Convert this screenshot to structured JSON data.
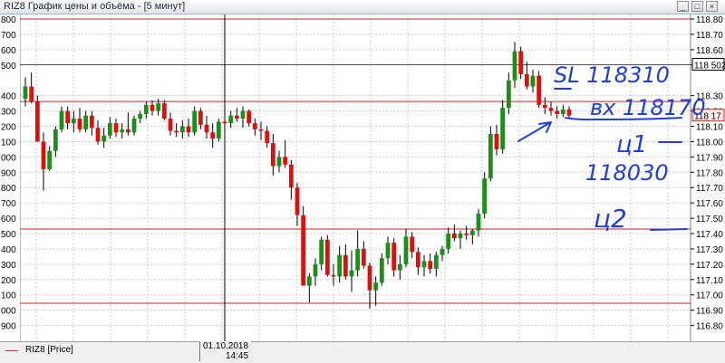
{
  "window": {
    "title": "RIZ8 График цены и объёма - [5 минут]",
    "buttons": [
      "_",
      "□",
      "×"
    ]
  },
  "legend": {
    "label": "RIZ8 [Price]",
    "color": "#d03030"
  },
  "cursor": {
    "date": "01.10.2018",
    "time": "14:45"
  },
  "chart_data": {
    "type": "candlestick",
    "title": "",
    "xlabel": "",
    "ylabel": "",
    "ylim": [
      116890,
      118800
    ],
    "left_tick_labels": [
      "800",
      "700",
      "600",
      "500",
      "400",
      "300",
      "200",
      "100",
      "000",
      "900",
      "800",
      "700",
      "600",
      "500",
      "400",
      "300",
      "200",
      "100",
      "000",
      "900"
    ],
    "right_tick_labels": [
      "118.80",
      "118.70",
      "118.60",
      "118.50",
      "118.30",
      "118.20",
      "118.10",
      "118.00",
      "117.90",
      "117.80",
      "117.70",
      "117.60",
      "117.50",
      "117.40",
      "117.30",
      "117.20",
      "117.10",
      "117.00",
      "116.90",
      "116.80"
    ],
    "right_tick_values": [
      118800,
      118700,
      118600,
      118500,
      118300,
      118200,
      118100,
      118000,
      117900,
      117800,
      117700,
      117600,
      117500,
      117400,
      117300,
      117200,
      117100,
      117000,
      116900,
      116800
    ],
    "price_tags": [
      {
        "label": "118 502",
        "value": 118502
      },
      {
        "label": "118 17",
        "value": 118170
      }
    ],
    "horizontal_lines": [
      {
        "value": 118800,
        "color": "#cc2222"
      },
      {
        "value": 118502,
        "color": "#555555"
      },
      {
        "value": 118262,
        "color": "#cc2222"
      },
      {
        "value": 117430,
        "color": "#cc2222"
      },
      {
        "value": 116945,
        "color": "#cc2222"
      }
    ],
    "candles": [
      [
        118280,
        118420,
        118230,
        118360
      ],
      [
        118360,
        118450,
        118250,
        118260
      ],
      [
        118260,
        118300,
        118020,
        118000
      ],
      [
        118000,
        118060,
        117680,
        117820
      ],
      [
        117820,
        117970,
        117810,
        117940
      ],
      [
        117940,
        118100,
        117900,
        118080
      ],
      [
        118080,
        118230,
        118060,
        118200
      ],
      [
        118200,
        118230,
        118080,
        118120
      ],
      [
        118120,
        118200,
        118060,
        118150
      ],
      [
        118150,
        118220,
        118060,
        118080
      ],
      [
        118080,
        118200,
        118060,
        118170
      ],
      [
        118170,
        118200,
        118040,
        118090
      ],
      [
        118090,
        118140,
        117980,
        118000
      ],
      [
        118000,
        118090,
        117960,
        118040
      ],
      [
        118040,
        118160,
        118020,
        118120
      ],
      [
        118120,
        118150,
        118030,
        118060
      ],
      [
        118060,
        118120,
        118020,
        118080
      ],
      [
        118080,
        118190,
        118040,
        118060
      ],
      [
        118060,
        118170,
        118040,
        118150
      ],
      [
        118150,
        118200,
        118120,
        118180
      ],
      [
        118180,
        118260,
        118150,
        118240
      ],
      [
        118240,
        118270,
        118170,
        118200
      ],
      [
        118200,
        118280,
        118170,
        118250
      ],
      [
        118250,
        118270,
        118140,
        118150
      ],
      [
        118150,
        118190,
        118040,
        118070
      ],
      [
        118070,
        118120,
        118030,
        118060
      ],
      [
        118060,
        118140,
        118020,
        118100
      ],
      [
        118100,
        118150,
        118030,
        118060
      ],
      [
        118060,
        118230,
        118040,
        118200
      ],
      [
        118200,
        118220,
        118080,
        118110
      ],
      [
        118110,
        118170,
        118020,
        118060
      ],
      [
        118060,
        118120,
        117960,
        118020
      ],
      [
        118020,
        118150,
        118000,
        118130
      ],
      [
        118130,
        118170,
        118080,
        118120
      ],
      [
        118120,
        118200,
        118090,
        118170
      ],
      [
        118170,
        118220,
        118130,
        118150
      ],
      [
        118150,
        118230,
        118090,
        118200
      ],
      [
        118200,
        118210,
        118100,
        118120
      ],
      [
        118120,
        118150,
        118040,
        118080
      ],
      [
        118080,
        118130,
        118010,
        118070
      ],
      [
        118070,
        118100,
        117960,
        117990
      ],
      [
        117990,
        118050,
        117780,
        117840
      ],
      [
        117840,
        117940,
        117800,
        117900
      ],
      [
        117900,
        118010,
        117830,
        117850
      ],
      [
        117850,
        117880,
        117620,
        117700
      ],
      [
        117700,
        117730,
        117450,
        117520
      ],
      [
        117520,
        117580,
        117140,
        117060
      ],
      [
        117060,
        117140,
        116950,
        117120
      ],
      [
        117120,
        117240,
        117060,
        117200
      ],
      [
        117200,
        117380,
        117160,
        117360
      ],
      [
        117360,
        117390,
        117120,
        117130
      ],
      [
        117130,
        117200,
        117060,
        117120
      ],
      [
        117120,
        117320,
        117080,
        117260
      ],
      [
        117260,
        117330,
        117100,
        117120
      ],
      [
        117120,
        117290,
        117020,
        117160
      ],
      [
        117160,
        117420,
        117120,
        117300
      ],
      [
        117300,
        117350,
        117170,
        117190
      ],
      [
        117190,
        117210,
        116910,
        117030
      ],
      [
        117030,
        117120,
        116930,
        117080
      ],
      [
        117080,
        117270,
        117060,
        117240
      ],
      [
        117240,
        117380,
        117200,
        117340
      ],
      [
        117340,
        117370,
        117120,
        117160
      ],
      [
        117160,
        117260,
        117100,
        117200
      ],
      [
        117200,
        117430,
        117180,
        117380
      ],
      [
        117380,
        117410,
        117240,
        117280
      ],
      [
        117280,
        117310,
        117130,
        117180
      ],
      [
        117180,
        117260,
        117120,
        117220
      ],
      [
        117220,
        117270,
        117140,
        117170
      ],
      [
        117170,
        117280,
        117120,
        117260
      ],
      [
        117260,
        117320,
        117220,
        117300
      ],
      [
        117300,
        117440,
        117270,
        117400
      ],
      [
        117400,
        117460,
        117350,
        117370
      ],
      [
        117370,
        117420,
        117300,
        117400
      ],
      [
        117400,
        117450,
        117360,
        117390
      ],
      [
        117390,
        117430,
        117330,
        117420
      ],
      [
        117420,
        117560,
        117380,
        117530
      ],
      [
        117530,
        117800,
        117500,
        117760
      ],
      [
        117760,
        118100,
        117740,
        118050
      ],
      [
        118050,
        118110,
        117910,
        117950
      ],
      [
        117950,
        118270,
        117920,
        118220
      ],
      [
        118220,
        118450,
        118180,
        118400
      ],
      [
        118400,
        118650,
        118350,
        118590
      ],
      [
        118590,
        118620,
        118410,
        118440
      ],
      [
        118440,
        118520,
        118340,
        118360
      ],
      [
        118360,
        118470,
        118320,
        118430
      ],
      [
        118430,
        118460,
        118220,
        118240
      ],
      [
        118240,
        118290,
        118180,
        118220
      ],
      [
        118220,
        118260,
        118170,
        118200
      ],
      [
        118200,
        118230,
        118150,
        118180
      ],
      [
        118180,
        118240,
        118160,
        118210
      ],
      [
        118210,
        118230,
        118150,
        118170
      ]
    ],
    "candle_colors": {
      "up": "#1a8f1a",
      "down": "#dd1010"
    },
    "grid": true,
    "annotations": {
      "handwritten": [
        "SL 118310",
        "вх 118170",
        "ц1",
        "118030",
        "ц2"
      ],
      "color": "#1f3fd8"
    }
  }
}
